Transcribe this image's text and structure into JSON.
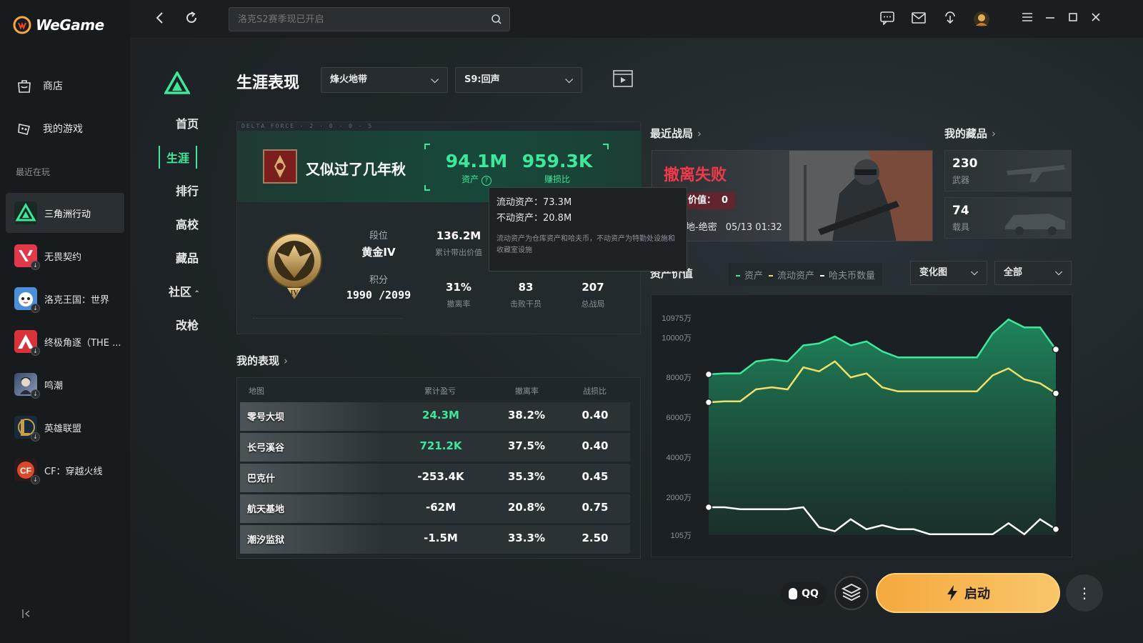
{
  "app": {
    "name": "WeGame"
  },
  "sidebar": {
    "nav": [
      {
        "label": "商店",
        "icon": "shop-bag-icon"
      },
      {
        "label": "我的游戏",
        "icon": "gamepad-icon"
      }
    ],
    "recent_label": "最近在玩",
    "games": [
      {
        "label": "三角洲行动",
        "color": "#1d8f5a"
      },
      {
        "label": "无畏契约",
        "color": "#e0394a"
      },
      {
        "label": "洛克王国：世界",
        "color": "#4a8fd8"
      },
      {
        "label": "终极角逐（THE ...",
        "color": "#d8333a"
      },
      {
        "label": "鸣潮",
        "color": "#5a6a8a"
      },
      {
        "label": "英雄联盟",
        "color": "#c8a04a"
      },
      {
        "label": "CF：穿越火线",
        "color": "#d84a2a"
      }
    ]
  },
  "topbar": {
    "search_placeholder": "洛克S2赛季现已开启"
  },
  "subnav": {
    "items": [
      "首页",
      "生涯",
      "排行",
      "高校",
      "藏品",
      "社区",
      "改枪"
    ],
    "active": "生涯"
  },
  "page": {
    "title": "生涯表现",
    "mode_select": "烽火地带",
    "season_select": "S9:回声"
  },
  "profile": {
    "tag": "DELTA FORCE · 2 · 0 · 0 · 5",
    "name": "又似过了几年秋",
    "assets_value": "94.1M",
    "assets_label": "资产",
    "ratio_value": "959.3K",
    "ratio_label": "赚损比",
    "rank_label": "段位",
    "rank_value": "黄金IV",
    "score_label": "积分",
    "score_value": "1990 /2099",
    "carry_value": "136.2M",
    "carry_label": "累计带出价值",
    "evac_rate_value": "31%",
    "evac_rate_label": "撤离率",
    "kills_value": "83",
    "kills_label": "击败干员",
    "matches_value": "207",
    "matches_label": "总战局"
  },
  "tooltip": {
    "liquid": "流动资产：73.3M",
    "fixed": "不动资产：20.8M",
    "note": "流动资产为仓库资产和哈夫币，不动资产为特勤处设施和收藏室设施"
  },
  "performance": {
    "title": "我的表现",
    "headers": [
      "地图",
      "累计盈亏",
      "撤离率",
      "战损比"
    ],
    "rows": [
      {
        "map": "零号大坝",
        "profit": "24.3M",
        "evac": "38.2%",
        "kd": "0.40",
        "positive": true
      },
      {
        "map": "长弓溪谷",
        "profit": "721.2K",
        "evac": "37.5%",
        "kd": "0.40",
        "positive": true
      },
      {
        "map": "巴克什",
        "profit": "-253.4K",
        "evac": "35.3%",
        "kd": "0.45",
        "positive": false
      },
      {
        "map": "航天基地",
        "profit": "-62M",
        "evac": "20.8%",
        "kd": "0.75",
        "positive": false
      },
      {
        "map": "潮汐监狱",
        "profit": "-1.5M",
        "evac": "33.3%",
        "kd": "2.50",
        "positive": false
      }
    ]
  },
  "recent": {
    "title": "最近战局",
    "result": "撤离失败",
    "value_label": "价值：",
    "value": "0",
    "map": "基地-绝密",
    "time": "05/13 01:32"
  },
  "collection": {
    "title": "我的藏品",
    "items": [
      {
        "value": "230",
        "label": "武器"
      },
      {
        "value": "74",
        "label": "载具"
      }
    ]
  },
  "asset_chart": {
    "title": "资产价值",
    "legend": [
      "资产",
      "流动资产",
      "哈夫币数量"
    ],
    "view_select": "变化图",
    "range_select": "全部"
  },
  "chart_data": {
    "type": "area",
    "title": "",
    "yticks": [
      "10975万",
      "10000万",
      "8000万",
      "6000万",
      "4000万",
      "2000万",
      "105万"
    ],
    "series": [
      {
        "name": "资产",
        "color": "#3ee89a",
        "values": [
          8150,
          8200,
          8200,
          8800,
          8900,
          8800,
          9600,
          9700,
          10050,
          9600,
          9800,
          9300,
          9000,
          9000,
          9000,
          9000,
          9000,
          9000,
          10200,
          10900,
          10500,
          10500,
          9400
        ]
      },
      {
        "name": "流动资产",
        "color": "#f0e06a",
        "values": [
          6750,
          6800,
          6800,
          7400,
          7500,
          7400,
          8500,
          8300,
          8800,
          8000,
          8200,
          7500,
          7300,
          7300,
          7300,
          7300,
          7300,
          7300,
          8100,
          8450,
          7900,
          7700,
          7200
        ]
      },
      {
        "name": "哈夫币数量",
        "color": "#ffffff",
        "values": [
          1500,
          1500,
          1400,
          1400,
          1400,
          1400,
          1500,
          500,
          300,
          900,
          400,
          600,
          400,
          400,
          150,
          150,
          150,
          150,
          150,
          700,
          150,
          900,
          400
        ]
      }
    ],
    "ylim": [
      105,
      10975
    ],
    "grid": false
  },
  "bottom": {
    "qq_label": "QQ",
    "launch_label": "启动"
  }
}
